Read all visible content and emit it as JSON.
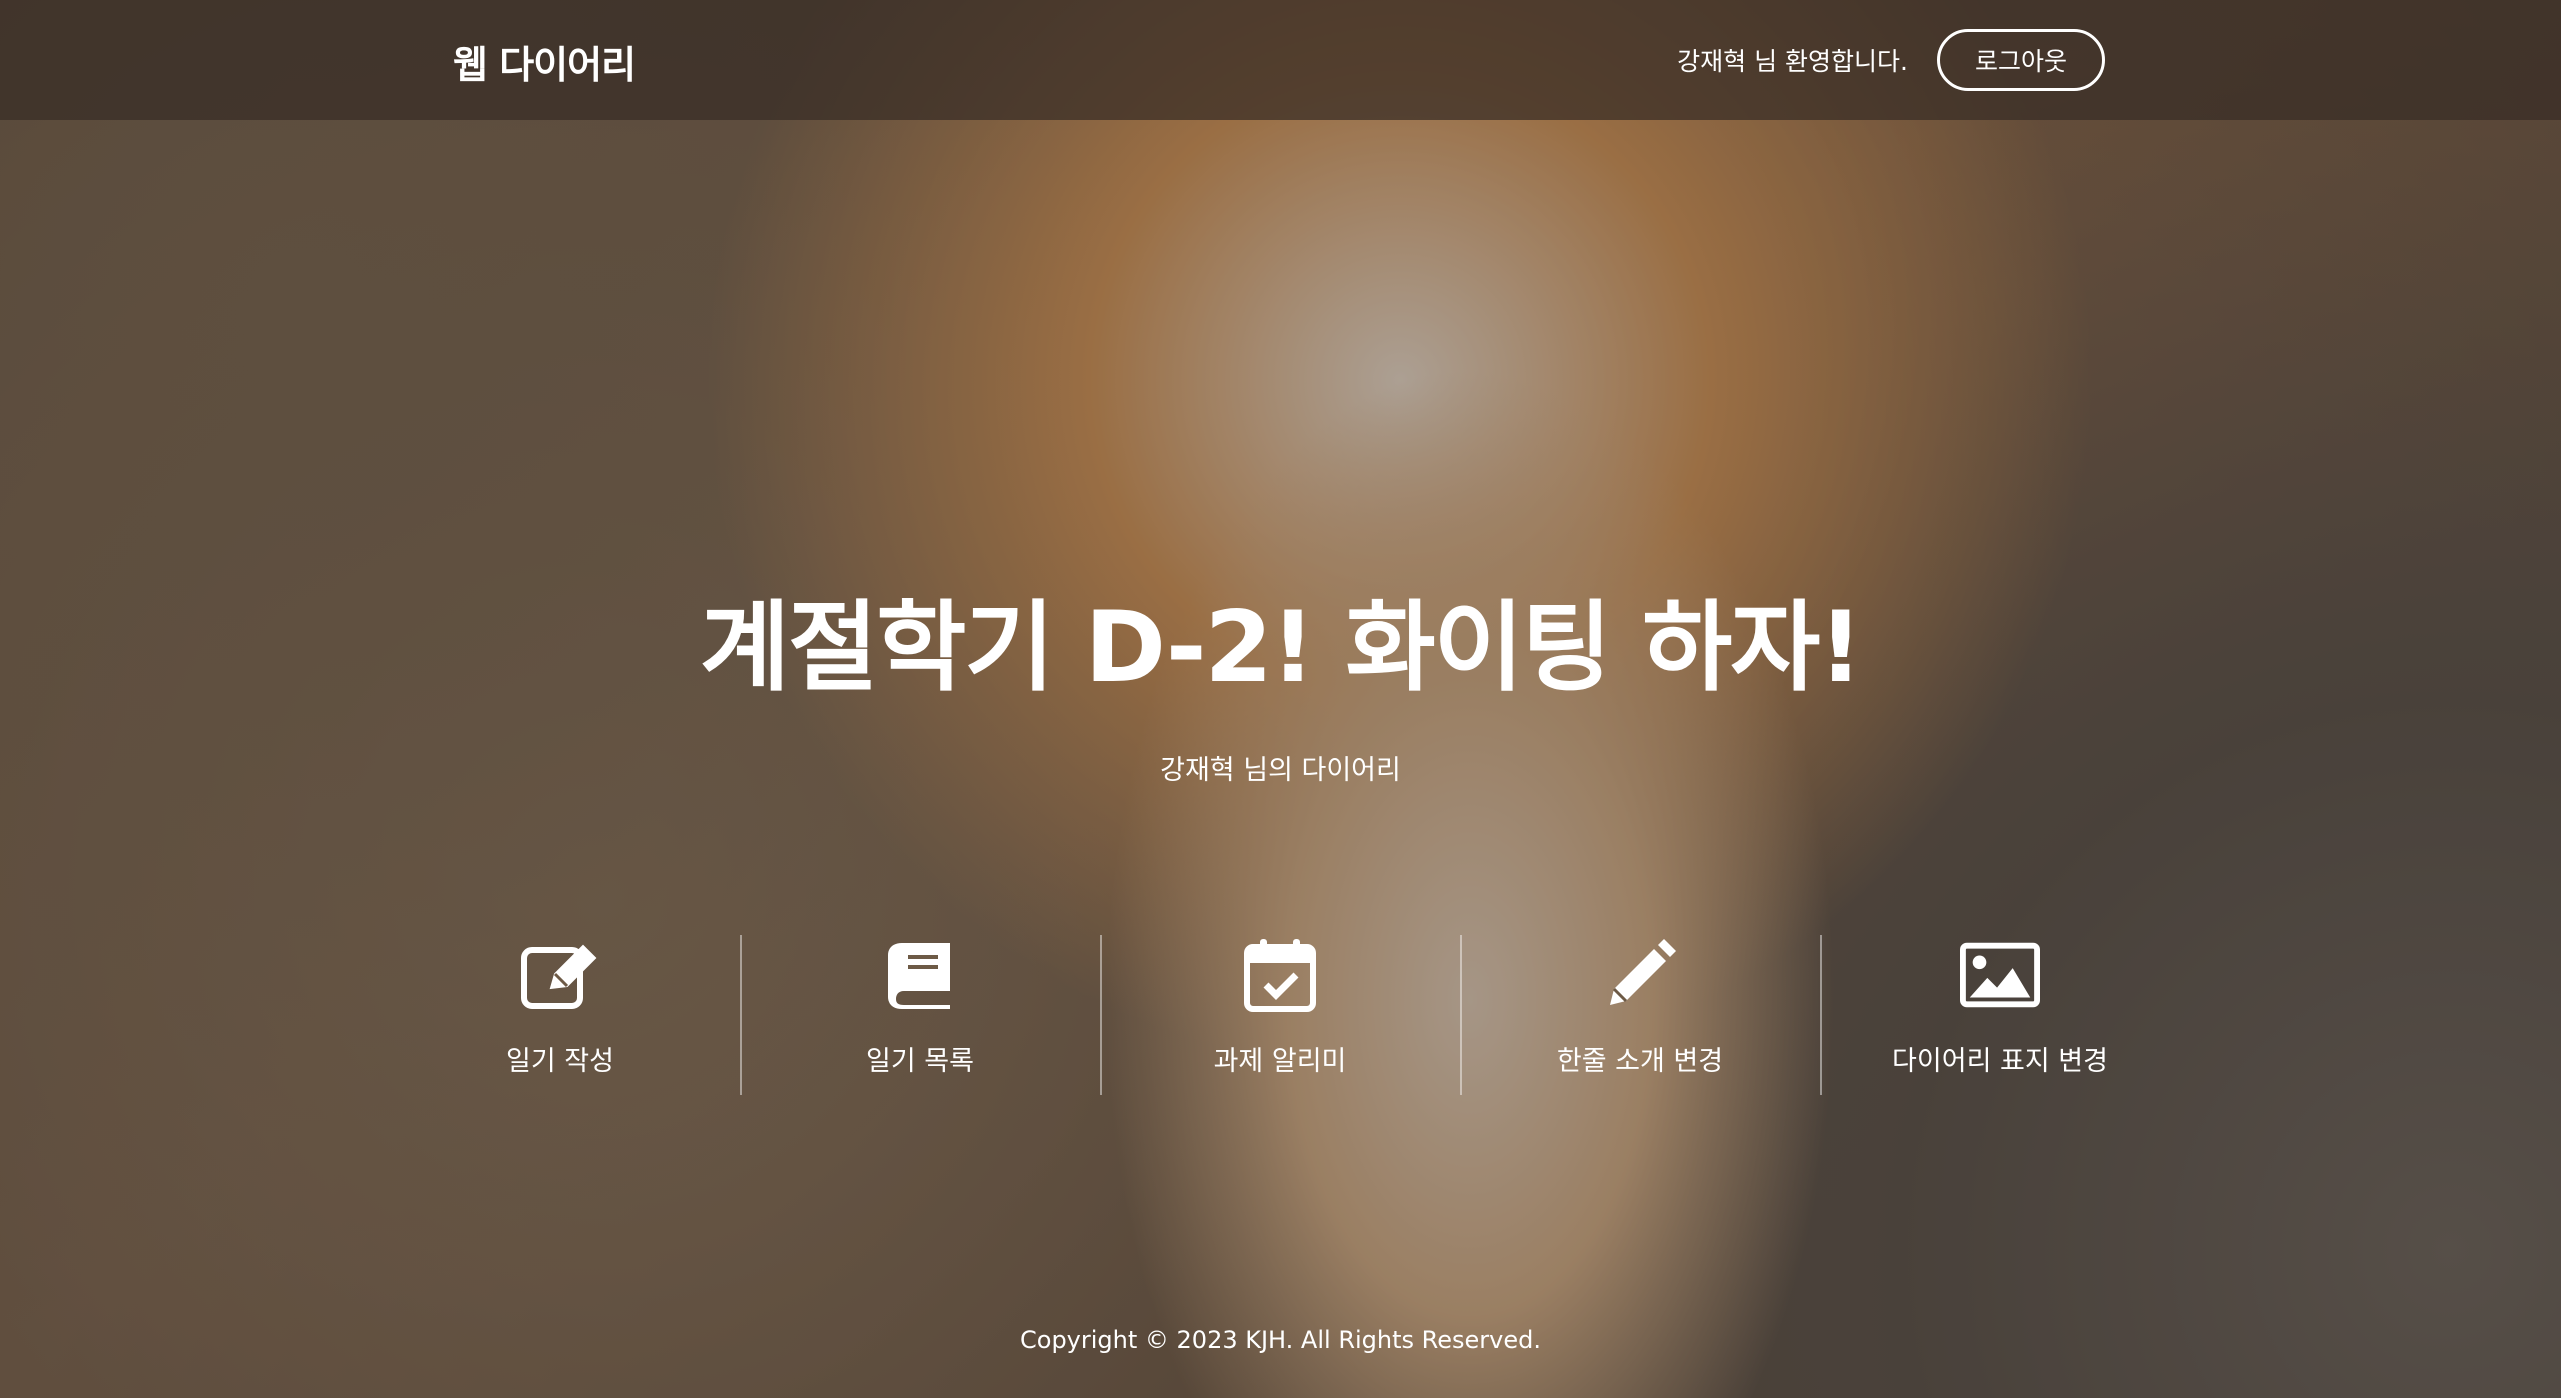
{
  "header": {
    "brand": "웹 다이어리",
    "welcome": "강재혁 님 환영합니다.",
    "logout_label": "로그아웃"
  },
  "hero": {
    "title": "계절학기 D-2! 화이팅 하자!",
    "subtitle": "강재혁 님의 다이어리"
  },
  "menu": {
    "items": [
      {
        "label": "일기 작성",
        "icon": "edit-icon"
      },
      {
        "label": "일기 목록",
        "icon": "book-icon"
      },
      {
        "label": "과제 알리미",
        "icon": "calendar-check-icon"
      },
      {
        "label": "한줄 소개 변경",
        "icon": "pencil-icon"
      },
      {
        "label": "다이어리 표지 변경",
        "icon": "image-icon"
      }
    ]
  },
  "footer": {
    "copyright": "Copyright © 2023 KJH. All Rights Reserved."
  }
}
